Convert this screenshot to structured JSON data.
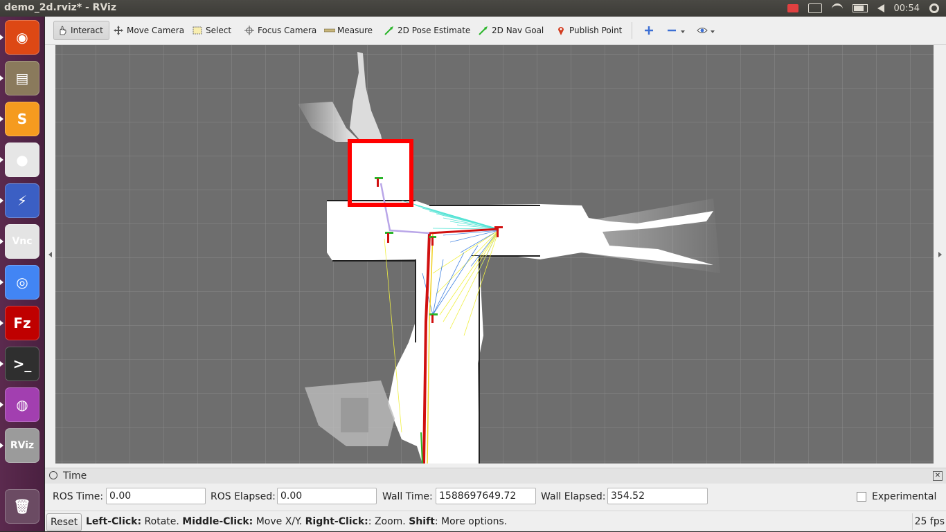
{
  "window": {
    "title": "demo_2d.rviz* - RViz"
  },
  "panel": {
    "clock": "00:54"
  },
  "launcher": {
    "items": [
      {
        "name": "ubuntu-dash",
        "glyph": "◉",
        "color": "#dd4814"
      },
      {
        "name": "files",
        "glyph": "▤",
        "color": "#8a7a5c"
      },
      {
        "name": "sublime-text",
        "glyph": "S",
        "color": "#f59b1f"
      },
      {
        "name": "github",
        "glyph": "●",
        "color": "#e6e6e6"
      },
      {
        "name": "network",
        "glyph": "⚡",
        "color": "#3b5fc4"
      },
      {
        "name": "vnc",
        "glyph": "Vnc",
        "color": "#e4e4e4"
      },
      {
        "name": "chrome",
        "glyph": "◎",
        "color": "#4285f4"
      },
      {
        "name": "filezilla",
        "glyph": "Fz",
        "color": "#bf0000"
      },
      {
        "name": "terminal",
        "glyph": ">_",
        "color": "#2f2f2f"
      },
      {
        "name": "camera-app",
        "glyph": "◍",
        "color": "#a23fb0"
      },
      {
        "name": "rviz",
        "glyph": "RViz",
        "color": "#9b9b9b"
      },
      {
        "name": "trash",
        "glyph": "🗑",
        "color": "#6b4b63"
      }
    ]
  },
  "toolbar": {
    "interact": "Interact",
    "move_camera": "Move Camera",
    "select": "Select",
    "focus_camera": "Focus Camera",
    "measure": "Measure",
    "pose_estimate": "2D Pose Estimate",
    "nav_goal": "2D Nav Goal",
    "publish_point": "Publish Point"
  },
  "time_panel": {
    "title": "Time",
    "ros_time_label": "ROS Time:",
    "ros_time": "0.00",
    "ros_elapsed_label": "ROS Elapsed:",
    "ros_elapsed": "0.00",
    "wall_time_label": "Wall Time:",
    "wall_time": "1588697649.72",
    "wall_elapsed_label": "Wall Elapsed:",
    "wall_elapsed": "354.52",
    "experimental_label": "Experimental"
  },
  "status_bar": {
    "reset": "Reset",
    "left_click": "Left-Click:",
    "left_click_action": " Rotate. ",
    "middle_click": "Middle-Click:",
    "middle_click_action": " Move X/Y. ",
    "right_click": "Right-Click:",
    "right_click_action": ": Zoom. ",
    "shift": "Shift",
    "shift_action": ": More options.",
    "fps": "25 fps"
  },
  "colors": {
    "grid_bg": "#6e6e6e",
    "free_space": "#ffffff",
    "highlight_box": "#ff0000",
    "laser_cyan": "#40e0d0",
    "laser_yellow": "#f0f040",
    "path_red": "#d01010"
  }
}
